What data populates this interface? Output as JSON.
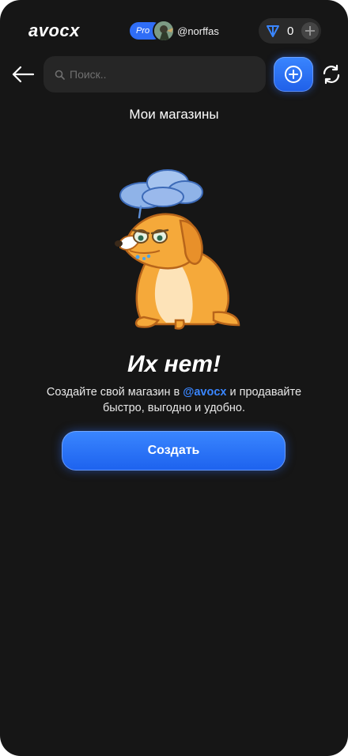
{
  "header": {
    "logo": "avocx",
    "pro_badge": "Pro",
    "username": "@norffas",
    "balance": "0"
  },
  "search": {
    "placeholder": "Поиск.."
  },
  "page": {
    "title": "Мои магазины"
  },
  "empty_state": {
    "title": "Их нет!",
    "text_before": "Создайте свой магазин в ",
    "mention": "@avocx",
    "text_after": " и продавайте быстро, выгодно и удобно.",
    "button_label": "Создать"
  },
  "colors": {
    "background": "#161616",
    "accent": "#2f6df6",
    "mention": "#3a86ff"
  },
  "icons": [
    "back-arrow-icon",
    "search-icon",
    "plus-circle-icon",
    "refresh-icon",
    "ton-icon",
    "plus-icon"
  ]
}
